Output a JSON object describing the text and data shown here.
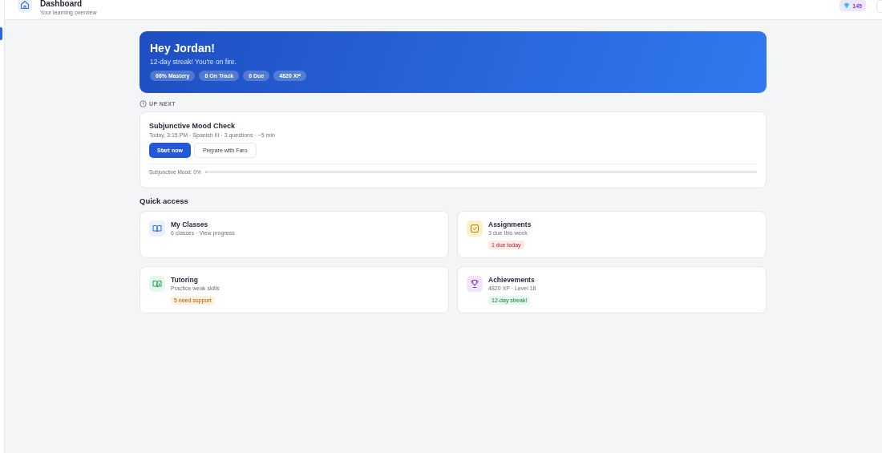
{
  "header": {
    "title": "Dashboard",
    "subtitle": "Your learning overview",
    "gems": "145"
  },
  "sidebar": {
    "items": [
      {
        "selected": true
      }
    ]
  },
  "hero": {
    "greeting": "Hey Jordan!",
    "message": "12-day streak! You're on fire.",
    "chips": [
      "66% Mastery",
      "8 On Track",
      "6 Due",
      "4820 XP"
    ]
  },
  "up_next": {
    "label": "UP NEXT",
    "title": "Subjunctive Mood Check",
    "meta": "Today, 3:15 PM · Spanish III · 3 questions · ~5 min",
    "buttons": [
      {
        "label": "Start now",
        "kind": "primary"
      },
      {
        "label": "Prepare with Faro",
        "kind": "secondary"
      }
    ],
    "progress": {
      "label": "Subjunctive Mood: 0%",
      "level": 0
    }
  },
  "quick_access": {
    "heading": "Quick access",
    "cards": [
      {
        "kind": "book",
        "title": "My Classes",
        "subtitle": "6 classes · View progress"
      },
      {
        "kind": "check",
        "title": "Assignments",
        "subtitle": "3 due this week",
        "tag": {
          "text": "1 due today",
          "kind": "danger"
        }
      },
      {
        "kind": "tutor",
        "title": "Tutoring",
        "subtitle": "Practice weak skills",
        "tag": {
          "text": "5 need support",
          "kind": "warning"
        }
      },
      {
        "kind": "trophy",
        "title": "Achievements",
        "subtitle": "4820 XP · Level 18",
        "tag": {
          "text": "12-day streak!",
          "kind": "success"
        }
      }
    ]
  }
}
